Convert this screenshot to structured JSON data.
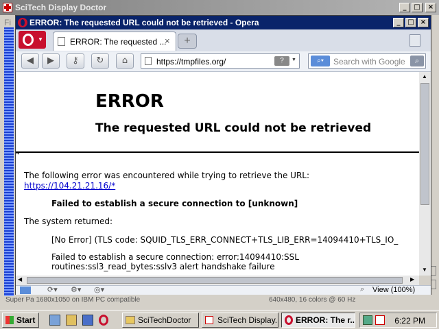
{
  "outer_window": {
    "title": "SciTech Display Doctor",
    "menu_partial": "Fi",
    "status_left": "Super Pa 1680x1050 on IBM PC compatible",
    "status_right": "640x480, 16 colors @ 60 Hz",
    "min": "_",
    "max": "□",
    "close": "×"
  },
  "opera_window": {
    "title": "ERROR: The requested URL could not be retrieved - Opera",
    "min": "_",
    "max": "□",
    "close": "×"
  },
  "tabs": [
    {
      "label": "ERROR: The requested ..."
    }
  ],
  "new_tab_label": "+",
  "address_bar": {
    "value": "https://tmpfiles.org/"
  },
  "search_bar": {
    "placeholder": "Search with Google"
  },
  "page": {
    "heading": "ERROR",
    "subheading": "The requested URL could not be retrieved",
    "intro": "The following error was encountered while trying to retrieve the URL:",
    "url": "https://104.21.21.16/*",
    "failure": "Failed to establish a secure connection to [unknown]",
    "system_returned": "The system returned:",
    "error_code": "[No Error] (TLS code: SQUID_TLS_ERR_CONNECT+TLS_LIB_ERR=14094410+TLS_IO_",
    "error_detail_1": "Failed to establish a secure connection: error:14094410:SSL",
    "error_detail_2": "routines:ssl3_read_bytes:sslv3 alert handshake failure"
  },
  "statusbar": {
    "zoom": "View (100%)"
  },
  "taskbar": {
    "start": "Start",
    "tasks": [
      {
        "label": "SciTechDoctor",
        "active": false
      },
      {
        "label": "SciTech Display...",
        "active": false
      },
      {
        "label": "ERROR: The r...",
        "active": true
      }
    ],
    "clock": "6:22 PM"
  },
  "colors": {
    "active_title": "#0a246a",
    "opera_red": "#c8102e",
    "link": "#0000cc"
  }
}
